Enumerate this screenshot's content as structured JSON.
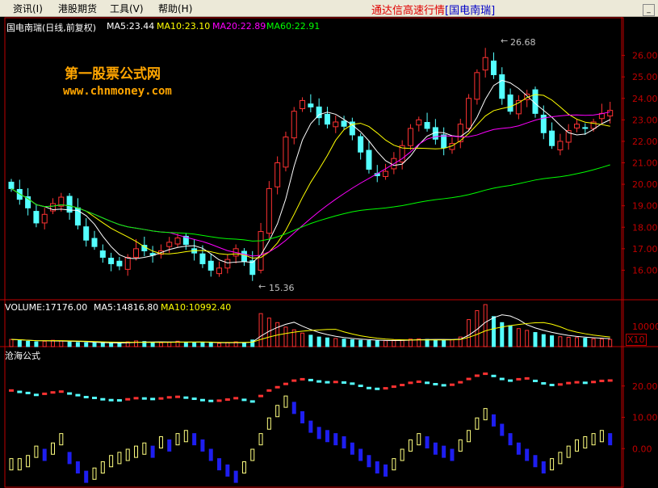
{
  "menu": {
    "items": [
      "资讯(I)",
      "港股期货",
      "工具(V)",
      "帮助(H)"
    ]
  },
  "market_title": {
    "prefix": "通达信高速行情",
    "stock": "[国电南瑞]"
  },
  "colors": {
    "up": "#ff3232",
    "down": "#54ffff",
    "ma5": "#ffffff",
    "ma10": "#ffff00",
    "ma20": "#ff00ff",
    "ma60": "#00ff00",
    "axis": "#c00000",
    "osc_up": "#ffff80",
    "osc_down": "#1e1ef0"
  },
  "price_panel": {
    "stock_label": "国电南瑞(日线,前复权)",
    "ma5": "MA5:23.44",
    "ma10": "MA10:23.10",
    "ma20": "MA20:22.89",
    "ma60": "MA60:22.91",
    "high_label": "26.68",
    "low_label": "15.36",
    "y_ticks": [
      "26.00",
      "25.00",
      "24.00",
      "23.00",
      "22.00",
      "21.00",
      "20.00",
      "19.00",
      "18.00",
      "17.00",
      "16.00"
    ]
  },
  "volume_panel": {
    "volume": "VOLUME:17176.00",
    "ma5": "MA5:14816.80",
    "ma10": "MA10:10992.40",
    "y_tick": "10000",
    "unit": "X10"
  },
  "indicator_panel": {
    "name": "沧海公式",
    "y_ticks": [
      "20.00",
      "10.00",
      "0.00"
    ]
  },
  "watermark": {
    "line1": "第一股票公式网",
    "line2": "www.chnmoney.com"
  },
  "chart_data": [
    {
      "type": "candlestick",
      "title": "国电南瑞(日线,前复权)",
      "ylim": [
        15.0,
        27.0
      ],
      "high": 26.68,
      "low": 15.36,
      "close_path": [
        19.8,
        19.3,
        18.9,
        18.2,
        18.6,
        19.1,
        19.4,
        18.7,
        18.1,
        17.4,
        17.1,
        16.6,
        16.3,
        16.2,
        16.6,
        17.0,
        16.9,
        16.7,
        16.9,
        17.3,
        17.5,
        17.2,
        16.8,
        16.3,
        16.0,
        16.1,
        16.5,
        17.0,
        16.4,
        15.8,
        17.8,
        19.8,
        21.0,
        22.2,
        23.4,
        23.9,
        23.6,
        23.1,
        22.8,
        22.9,
        22.7,
        22.3,
        21.5,
        20.7,
        20.4,
        20.6,
        21.2,
        21.8,
        22.6,
        23.0,
        22.6,
        22.1,
        21.7,
        21.9,
        22.8,
        24.0,
        25.2,
        25.9,
        25.1,
        24.0,
        23.4,
        23.9,
        24.2,
        23.3,
        22.4,
        21.8,
        22.0,
        22.5,
        22.8,
        22.6,
        22.9,
        23.3,
        23.44
      ]
    },
    {
      "type": "bar",
      "title": "VOLUME",
      "ylim": [
        0,
        14000
      ],
      "values": [
        2400,
        2200,
        1800,
        1600,
        1800,
        2100,
        1900,
        1500,
        1400,
        1300,
        1200,
        1300,
        1200,
        1100,
        1600,
        1900,
        1700,
        1400,
        1300,
        1500,
        1800,
        1500,
        1400,
        1300,
        1200,
        1100,
        1400,
        1600,
        1300,
        2200,
        11000,
        9500,
        8000,
        6500,
        5600,
        4500,
        3800,
        3200,
        2900,
        2700,
        2500,
        2300,
        2100,
        2000,
        1900,
        2000,
        2100,
        2200,
        2500,
        2600,
        2400,
        2300,
        2200,
        2300,
        3200,
        9000,
        12000,
        14000,
        10000,
        8000,
        7000,
        6000,
        5400,
        4700,
        4000,
        3600,
        3300,
        3100,
        3000,
        2800,
        2600,
        2500,
        2400
      ]
    },
    {
      "type": "line",
      "title": "沧海公式",
      "ylim": [
        -10,
        30
      ],
      "upper_series_y_range": [
        15,
        25
      ],
      "osc_values": [
        -5,
        -5,
        -4,
        -1,
        -2,
        0,
        3,
        -3,
        -6,
        -9,
        -8,
        -6,
        -4,
        -3,
        -2,
        -1,
        0,
        -1,
        2,
        1,
        3,
        4,
        3,
        1,
        -2,
        -5,
        -7,
        -9,
        -6,
        -2,
        3,
        8,
        12,
        15,
        13,
        10,
        7,
        5,
        4,
        3,
        2,
        0,
        -2,
        -4,
        -6,
        -7,
        -5,
        -2,
        1,
        3,
        2,
        0,
        -1,
        -2,
        1,
        4,
        8,
        11,
        9,
        6,
        3,
        0,
        -2,
        -4,
        -6,
        -5,
        -3,
        -1,
        1,
        2,
        3,
        4,
        3
      ]
    }
  ]
}
